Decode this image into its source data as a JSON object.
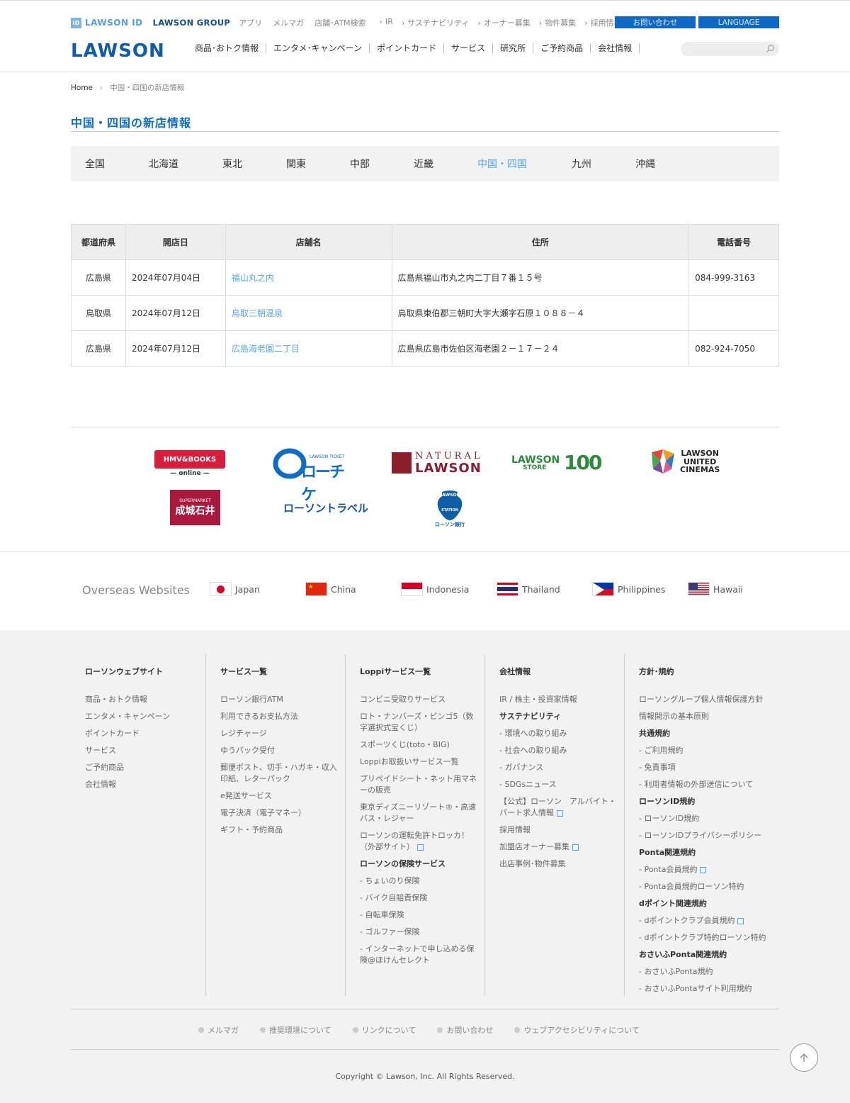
{
  "header": {
    "lawson_id": "LAWSON ID",
    "lawson_group": "LAWSON GROUP",
    "top_links": [
      "アプリ",
      "メルマガ",
      "店舗･ATM検索"
    ],
    "top_links2": [
      "IR",
      "サステナビリティ",
      "オーナー募集",
      "物件募集",
      "採用情報"
    ],
    "contact": "お問い合わせ",
    "language": "LANGUAGE",
    "logo": "LAWSON",
    "nav": [
      "商品･おトク情報",
      "エンタメ･キャンペーン",
      "ポイントカード",
      "サービス",
      "研究所",
      "ご予約商品",
      "会社情報"
    ],
    "search_placeholder": ""
  },
  "breadcrumb": {
    "home": "Home",
    "current": "中国・四国の新店情報"
  },
  "page_title": "中国・四国の新店情報",
  "regions": {
    "items": [
      "全国",
      "北海道",
      "東北",
      "関東",
      "中部",
      "近畿",
      "中国・四国",
      "九州",
      "沖縄"
    ],
    "active": "中国・四国"
  },
  "table": {
    "headers": [
      "都道府県",
      "開店日",
      "店舗名",
      "住所",
      "電話番号"
    ],
    "rows": [
      {
        "pref": "広島県",
        "date": "2024年07月04日",
        "name": "福山丸之内",
        "address": "広島県福山市丸之内二丁目７番１５号",
        "phone": "084-999-3163"
      },
      {
        "pref": "鳥取県",
        "date": "2024年07月12日",
        "name": "鳥取三朝温泉",
        "address": "鳥取県東伯郡三朝町大字大瀬字石原１０８８－４",
        "phone": ""
      },
      {
        "pref": "広島県",
        "date": "2024年07月12日",
        "name": "広島海老園二丁目",
        "address": "広島県広島市佐伯区海老園２－１７－２４",
        "phone": "082-924-7050"
      }
    ]
  },
  "brands": {
    "hmv_top": "HMV&BOOKS",
    "hmv_bottom": "— online —",
    "lticket_small": "LAWSON TICKET",
    "lticket": "ローチケ",
    "natural_top": "NATURAL",
    "natural_bottom": "LAWSON",
    "ls100_a": "LAWSON",
    "ls100_b": "STORE",
    "ls100_c": "100",
    "cinemas": [
      "LAWSON",
      "UNITED",
      "CINEMAS"
    ],
    "seijo_small": "SUPERMARKET",
    "seijo": "成城石井",
    "travel": "ローソントラベル",
    "station_top": "LAWSON",
    "station_mid": "STATION",
    "station_bottom": "ローソン銀行"
  },
  "overseas": {
    "label": "Overseas Websites",
    "countries": [
      "Japan",
      "China",
      "Indonesia",
      "Thailand",
      "Philippines",
      "Hawaii"
    ]
  },
  "footer": {
    "columns": [
      {
        "title": "ローソンウェブサイト",
        "items": [
          {
            "t": "商品・おトク情報"
          },
          {
            "t": "エンタメ・キャンペーン"
          },
          {
            "t": "ポイントカード"
          },
          {
            "t": "サービス"
          },
          {
            "t": "ご予約商品"
          },
          {
            "t": "会社情報"
          }
        ]
      },
      {
        "title": "サービス一覧",
        "items": [
          {
            "t": "ローソン銀行ATM"
          },
          {
            "t": "利用できるお支払方法"
          },
          {
            "t": "レジチャージ"
          },
          {
            "t": "ゆうパック受付"
          },
          {
            "t": "郵便ポスト、切手・ハガキ・収入印紙、レターパック"
          },
          {
            "t": "e発送サービス"
          },
          {
            "t": "電子決済（電子マネー）"
          },
          {
            "t": "ギフト・予約商品"
          }
        ]
      },
      {
        "title": "Loppiサービス一覧",
        "items": [
          {
            "t": "コンビニ受取りサービス"
          },
          {
            "t": "ロト・ナンバーズ・ビンゴ5（数字選択式宝くじ）"
          },
          {
            "t": "スポーツくじ(toto・BIG)"
          },
          {
            "t": "Loppiお取扱いサービス一覧"
          },
          {
            "t": "プリペイドシート・ネット用マネーの販売"
          },
          {
            "t": "東京ディズニーリゾート®・高速バス・レジャー"
          },
          {
            "t": "ローソンの運転免許トロッカ！（外部サイト）",
            "ext": true
          },
          {
            "t": "ローソンの保険サービス",
            "h": true
          },
          {
            "t": "- ちょいのり保険"
          },
          {
            "t": "- バイク自賠責保険"
          },
          {
            "t": "- 自転車保険"
          },
          {
            "t": "- ゴルファー保険"
          },
          {
            "t": "- インターネットで申し込める保険@ほけんセレクト"
          }
        ]
      },
      {
        "title": "会社情報",
        "items": [
          {
            "t": "IR / 株主・投資家情報"
          },
          {
            "t": "サステナビリティ",
            "h": true
          },
          {
            "t": "- 環境への取り組み"
          },
          {
            "t": "- 社会への取り組み"
          },
          {
            "t": "- ガバナンス"
          },
          {
            "t": "- SDGsニュース"
          },
          {
            "t": "【公式】ローソン　アルバイト・パート求人情報",
            "ext": true
          },
          {
            "t": "採用情報"
          },
          {
            "t": "加盟店オーナー募集",
            "ext": true
          },
          {
            "t": "出店事例･物件募集"
          }
        ]
      },
      {
        "title": "方針･規約",
        "items": [
          {
            "t": "ローソングループ個人情報保護方針"
          },
          {
            "t": "情報開示の基本原則"
          },
          {
            "t": "共通規約",
            "h": true
          },
          {
            "t": "- ご利用規約"
          },
          {
            "t": "- 免責事項"
          },
          {
            "t": "- 利用者情報の外部送信について"
          },
          {
            "t": "ローソンID規約",
            "h": true
          },
          {
            "t": "- ローソンID規約"
          },
          {
            "t": "- ローソンIDプライバシーポリシー"
          },
          {
            "t": "Ponta関連規約",
            "h": true
          },
          {
            "t": "- Ponta会員規約",
            "ext": true
          },
          {
            "t": "- Ponta会員規約ローソン特約"
          },
          {
            "t": "dポイント関連規約",
            "h": true
          },
          {
            "t": "- dポイントクラブ会員規約",
            "ext": true
          },
          {
            "t": "- dポイントクラブ特約ローソン特約"
          },
          {
            "t": "おさいふPonta関連規約",
            "h": true
          },
          {
            "t": "- おさいふPonta規約"
          },
          {
            "t": "- おさいふPontaサイト利用規約"
          }
        ]
      }
    ],
    "bottom_links": [
      "メルマガ",
      "推奨環境について",
      "リンクについて",
      "お問い合わせ",
      "ウェブアクセシビリティについて"
    ],
    "copyright": "Copyright © Lawson, Inc. All Rights Reserved."
  }
}
